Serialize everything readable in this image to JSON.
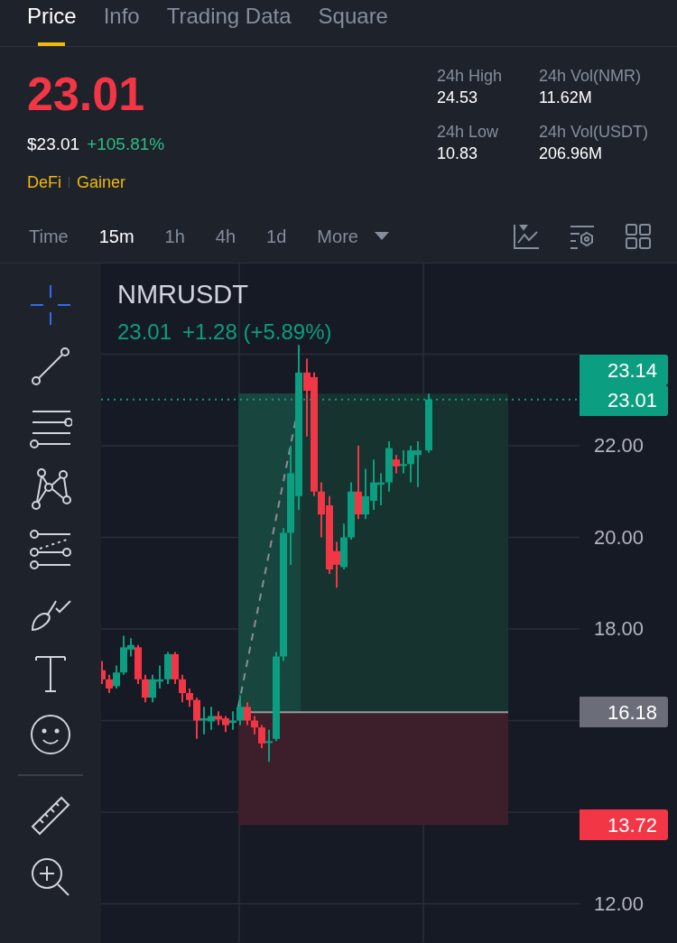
{
  "tabs": [
    {
      "label": "Price",
      "selected": true
    },
    {
      "label": "Info",
      "selected": false
    },
    {
      "label": "Trading Data",
      "selected": false
    },
    {
      "label": "Square",
      "selected": false
    }
  ],
  "price": {
    "last": "23.01",
    "fiat": "$23.01",
    "change": "+105.81%",
    "tags": [
      "DeFi",
      "Gainer"
    ]
  },
  "stats": [
    {
      "label": "24h High",
      "value": "24.53"
    },
    {
      "label": "24h Vol(NMR)",
      "value": "11.62M"
    },
    {
      "label": "24h Low",
      "value": "10.83"
    },
    {
      "label": "24h Vol(USDT)",
      "value": "206.96M"
    }
  ],
  "intervals": [
    {
      "label": "Time",
      "selected": false
    },
    {
      "label": "15m",
      "selected": true
    },
    {
      "label": "1h",
      "selected": false
    },
    {
      "label": "4h",
      "selected": false
    },
    {
      "label": "1d",
      "selected": false
    },
    {
      "label": "More",
      "selected": false,
      "kind": "dropdown"
    }
  ],
  "toolbar": [
    {
      "selected": true
    },
    {
      "selected": false
    },
    {
      "selected": false
    },
    {
      "selected": false
    },
    {
      "selected": false
    },
    {
      "selected": false
    },
    {
      "selected": false
    },
    {
      "selected": false
    },
    {
      "selected": false
    },
    {
      "selected": false
    }
  ],
  "chart": {
    "symbol": "NMRUSDT",
    "quote": "23.01",
    "change": "+1.28",
    "percent": "(+5.89%)",
    "axis_labels": [
      "22.00",
      "20.00",
      "18.00",
      "12.00"
    ],
    "price_tags": [
      {
        "text": "23.14",
        "kind": "up"
      },
      {
        "text": "23.01",
        "kind": "up"
      },
      {
        "text": "16.18",
        "kind": "neutral"
      },
      {
        "text": "13.72",
        "kind": "down"
      }
    ]
  }
}
